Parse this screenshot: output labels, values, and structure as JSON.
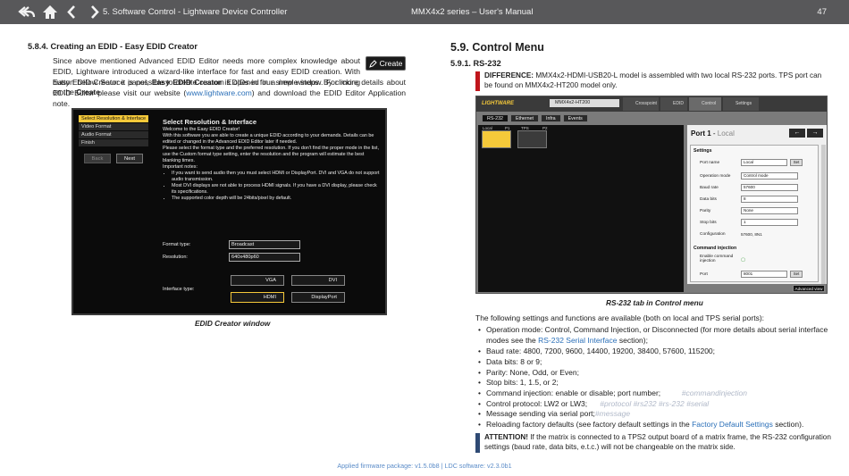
{
  "header": {
    "chapter": "5. Software Control - Lightware Device Controller",
    "manual": "MMX4x2 series – User's Manual",
    "page": "47",
    "nav_icons": [
      "back-icon",
      "home-icon",
      "prev-icon",
      "next-icon"
    ]
  },
  "left": {
    "heading": "5.8.4. Creating an EDID - Easy EDID Creator",
    "para1": "Since above mentioned Advanced EDID Editor needs more complex knowledge about EDID, Lightware introduced a wizard-like interface for fast and easy EDID creation. With Easy EDID Creator it is possible to create custom EDIDs in four simple steps. By clicking on the",
    "create_word": "Create",
    "para1_tail": "button below Source panel,",
    "easy_edid_creator": "Easy EDID Creator",
    "para2": "is opened in a new window. For more details about EDID Editor please visit our website (",
    "website": "www.lightware.com",
    "para3": ") and download the EDID Editor Application note.",
    "create_button": "Create",
    "caption": "EDID Creator window"
  },
  "edid_window": {
    "menu": [
      "Select Resolution & Interface",
      "Video Format",
      "Audio Format",
      "Finish"
    ],
    "back": "Back",
    "next": "Next",
    "title": "Select Resolution & Interface",
    "welcome": "Welcome to the Easy EDID Creator!",
    "text1": "With this software you are able to create a unique EDID according to your demands. Details can be edited or changed in the Advanced EDID Editor later if needed.",
    "text2": "Please select the format type and the preferred resolution. If you don't find the proper mode in the list, use the Custom format type setting, enter the resolution and the program will estimate the best blanking times.",
    "notes_title": "Important notes:",
    "notes": [
      "If you want to send audio then you must select HDMI or DisplayPort. DVI and VGA do not support audio transmission.",
      "Most DVI displays are not able to process HDMI signals. If you have a DVI display, please check its specifications.",
      "The supported color depth will be 24bits/pixel by default."
    ],
    "format_type_label": "Format type:",
    "format_type": "Broadcast",
    "resolution_label": "Resolution:",
    "resolution": "640x480p60",
    "interface_label": "Interface type:",
    "interfaces": [
      "VGA",
      "DVI",
      "HDMI",
      "DisplayPort"
    ]
  },
  "right": {
    "heading": "5.9. Control Menu",
    "subheading": "5.9.1. RS-232",
    "difference_label": "DIFFERENCE:",
    "difference": "MMX4x2-HDMI-USB20-L model is assembled with two local RS-232 ports. TPS port can be found on MMX4x2-HT200 model only.",
    "caption": "RS-232 tab in Control menu",
    "intro": "The following settings and functions are available (both on local and TPS serial ports):",
    "bullets": [
      {
        "text": "Operation mode: Control, Command Injection, or Disconnected (for more details about serial interface modes see the ",
        "link": "RS-232 Serial Interface",
        "tail": " section);",
        "ghost": ""
      },
      {
        "text": "Baud rate: 4800, 7200, 9600, 14400, 19200, 38400, 57600, 115200;",
        "link": "",
        "tail": "",
        "ghost": ""
      },
      {
        "text": "Data bits: 8 or 9;",
        "link": "",
        "tail": "",
        "ghost": ""
      },
      {
        "text": "Parity: None, Odd, or Even;",
        "link": "",
        "tail": "",
        "ghost": ""
      },
      {
        "text": "Stop bits: 1, 1.5, or 2;",
        "link": "",
        "tail": "",
        "ghost": ""
      },
      {
        "text": "Command injection: enable or disable; port number;",
        "link": "",
        "tail": "",
        "ghost": "#commandinjection"
      },
      {
        "text": "Control protocol: LW2 or LW3;",
        "link": "",
        "tail": "",
        "ghost": "#protocol          #rs232  #rs-232 #serial"
      },
      {
        "text": "Message sending via serial port;",
        "link": "",
        "tail": "",
        "ghost": "#message"
      },
      {
        "text": "Reloading factory defaults (see factory default settings in the ",
        "link": "Factory Default Settings",
        "tail": " section).",
        "ghost": ""
      }
    ],
    "attention_label": "ATTENTION!",
    "attention": "If the matrix is connected to a TPS2 output board of a matrix frame, the RS-232 configuration settings (baud rate, data bits, e.t.c.) will not be changeable on the matrix side."
  },
  "rs232_window": {
    "logo": "LIGHTWARE",
    "device": "MMX4x2-HT200",
    "menu": [
      "Crosspoint",
      "EDID",
      "Control",
      "Settings"
    ],
    "active_menu": "Control",
    "tabs": [
      "RS-232",
      "Ethernet",
      "Infra",
      "Events"
    ],
    "port_labels": [
      "Local",
      "P1",
      "TPS",
      "P2"
    ],
    "port_title": "Port 1",
    "port_sub": "Local",
    "settings_title": "Settings",
    "rows": [
      {
        "label": "Port name",
        "value": "Local",
        "button": "Set"
      },
      {
        "label": "Operation mode",
        "value": "Control mode",
        "button": ""
      },
      {
        "label": "Baud rate",
        "value": "57600",
        "button": ""
      },
      {
        "label": "Data bits",
        "value": "8",
        "button": ""
      },
      {
        "label": "Parity",
        "value": "None",
        "button": ""
      },
      {
        "label": "Stop bits",
        "value": "1",
        "button": ""
      },
      {
        "label": "Configuration",
        "value": "57600, 8N1",
        "button": ""
      }
    ],
    "cmd_title": "Command injection",
    "enable_label": "Enable command injection",
    "port_label": "Port",
    "port_value": "8001",
    "port_button": "Set",
    "advanced": "Advanced view"
  },
  "footer": "Applied firmware package: v1.5.0b8    |    LDC software: v2.3.0b1"
}
